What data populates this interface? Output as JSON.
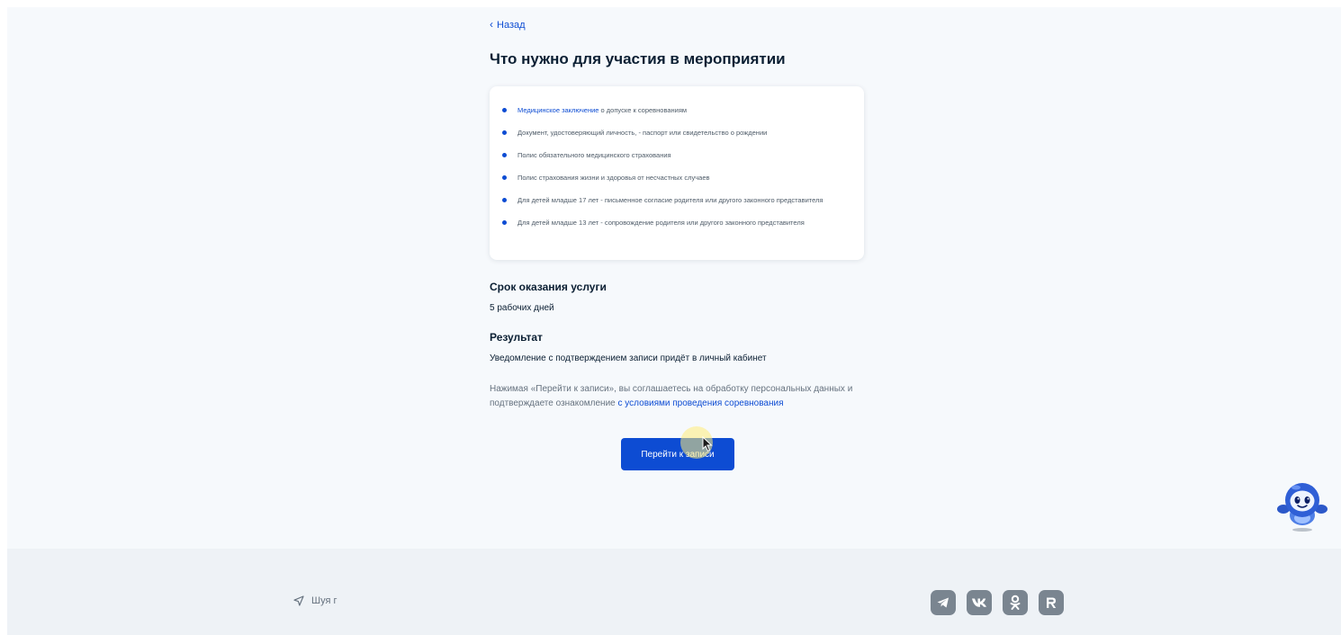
{
  "nav": {
    "back_label": "Назад"
  },
  "page": {
    "title": "Что нужно для участия в мероприятии"
  },
  "requirements": [
    {
      "link": "Медицинское заключение",
      "text": " о допуске к соревнованиям"
    },
    {
      "link": "",
      "text": "Документ, удостоверяющий личность, - паспорт или свидетельство о рождении"
    },
    {
      "link": "",
      "text": "Полис обязательного медицинского страхования"
    },
    {
      "link": "",
      "text": "Полис страхования жизни и здоровья от несчастных случаев"
    },
    {
      "link": "",
      "text": "Для детей младше 17 лет - письменное согласие родителя или другого законного представителя"
    },
    {
      "link": "",
      "text": "Для детей младше 13 лет - сопровождение родителя или другого законного представителя"
    }
  ],
  "term": {
    "title": "Срок оказания услуги",
    "value": "5 рабочих дней"
  },
  "result": {
    "title": "Результат",
    "value": "Уведомление с подтверждением записи придёт в личный кабинет"
  },
  "consent": {
    "text": "Нажимая «Перейти к записи», вы соглашаетесь на обработку персональных данных и подтверждаете ознакомление ",
    "link": "с условиями проведения соревнования"
  },
  "actions": {
    "primary_label": "Перейти к записи"
  },
  "footer": {
    "location": "Шуя г",
    "social": [
      "telegram-icon",
      "vk-icon",
      "ok-icon",
      "rutube-icon"
    ]
  },
  "colors": {
    "accent": "#0d4cd3",
    "background": "#f6f9fc",
    "footer_bg": "#eef2f6",
    "social_icon_bg": "#7a8590",
    "text_primary": "#0b1f33",
    "text_secondary": "#66727f"
  }
}
